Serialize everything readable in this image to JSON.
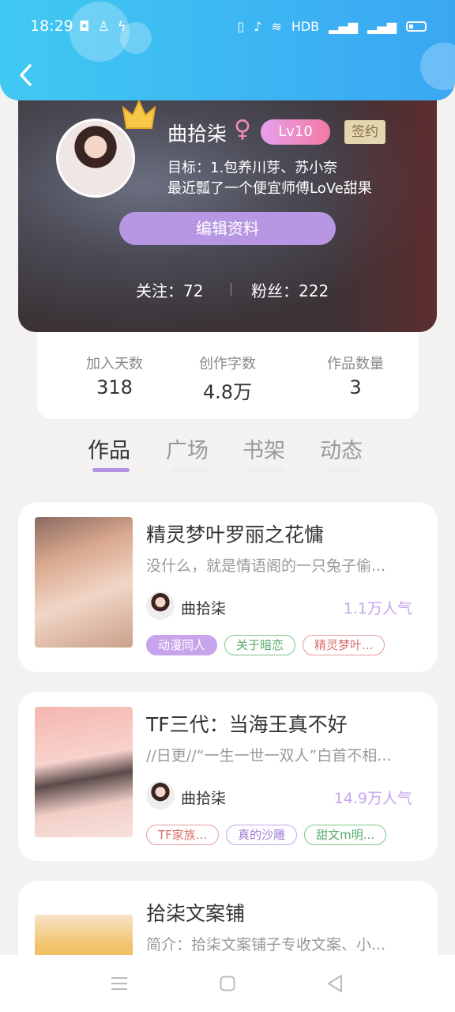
{
  "status_bar": {
    "time": "18:29",
    "right_text": "HDB"
  },
  "profile": {
    "name": "曲拾柒",
    "gender_symbol": "♀",
    "level": "Lv10",
    "sign_badge": "签约",
    "goal_line1": "目标：1.包养川芽、苏小奈",
    "goal_line2": "最近瓢了一个便宜师傅LoVe甜果",
    "edit_button": "编辑资料",
    "follow_label": "关注：72",
    "fans_label": "粉丝：222"
  },
  "stats": [
    {
      "label": "加入天数",
      "value": "318"
    },
    {
      "label": "创作字数",
      "value": "4.8万"
    },
    {
      "label": "作品数量",
      "value": "3"
    }
  ],
  "tabs": [
    "作品",
    "广场",
    "书架",
    "动态"
  ],
  "works": [
    {
      "title": "精灵梦叶罗丽之花慵",
      "desc": "没什么，就是情语阁的一只兔子偷...",
      "author": "曲拾柒",
      "popularity": "1.1万人气",
      "tags": [
        "动漫同人",
        "关于暗恋",
        "精灵梦叶..."
      ]
    },
    {
      "title": "TF三代：当海王真不好",
      "desc": "//日更//“一生一世一双人”白首不相...",
      "author": "曲拾柒",
      "popularity": "14.9万人气",
      "tags": [
        "TF家族...",
        "真的沙雕",
        "甜文m明..."
      ]
    },
    {
      "title": "拾柒文案铺",
      "desc": "简介：拾柒文案铺子专收文案、小...",
      "author": "",
      "popularity": "",
      "tags": []
    }
  ],
  "colors": {
    "accent": "#b390e2",
    "topbar": "#3fb7f2"
  }
}
